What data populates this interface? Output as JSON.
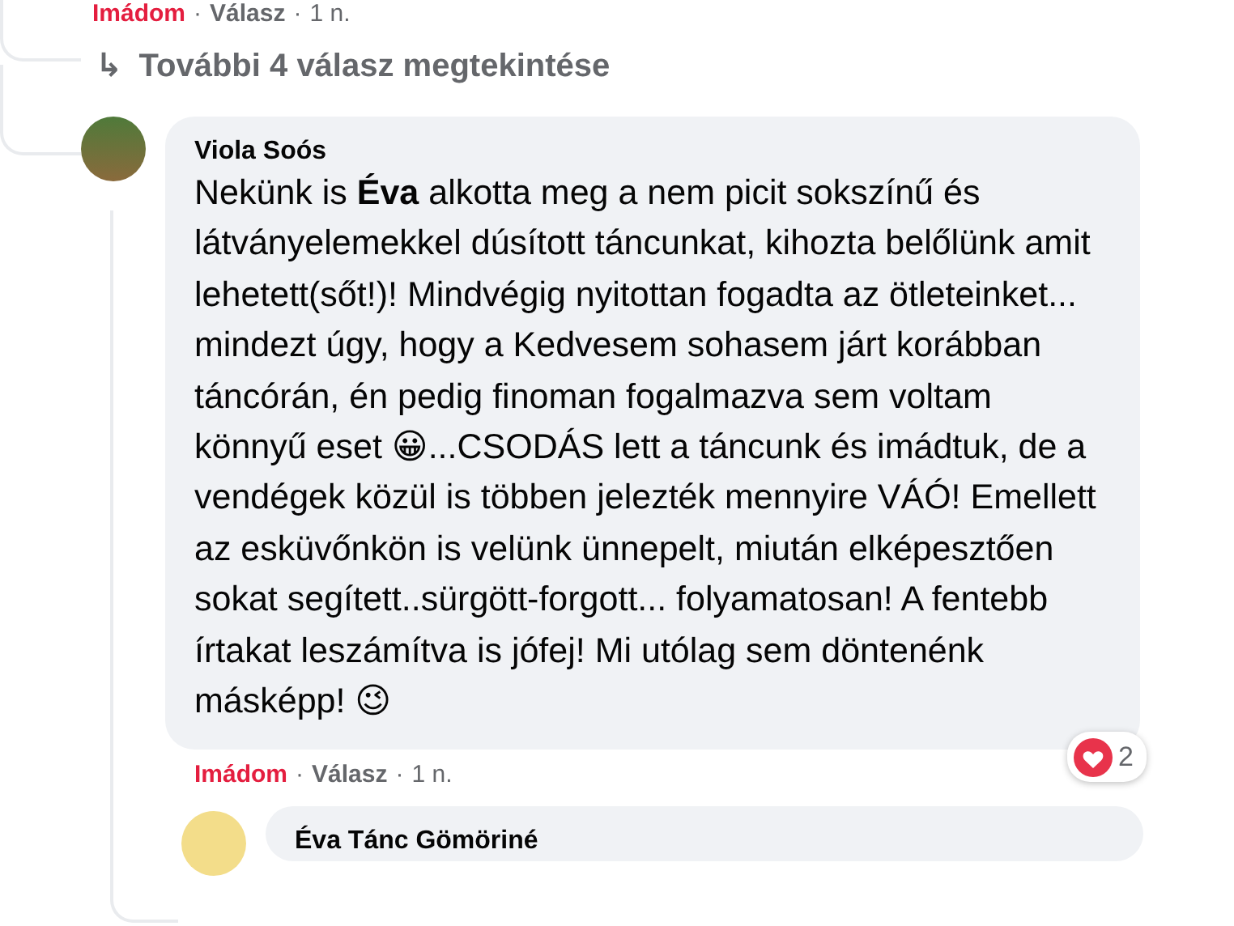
{
  "previous_comment_actions": {
    "reaction": "Imádom",
    "reacted": true,
    "separator": "·",
    "reply": "Válasz",
    "time": "1 n."
  },
  "more_replies": {
    "arrow": "↳",
    "label": "További 4 válasz megtekintése"
  },
  "comments": [
    {
      "author": "Viola Soós",
      "text": "Nekünk is **Éva** alkotta meg a nem picit sokszínű és látványelemekkel dúsított táncunkat, kihozta belőlünk amit lehetett(sőt!)! Mindvégig nyitottan fogadta az ötleteinket... mindezt úgy, hogy a Kedvesem sohasem járt korábban táncórán, én pedig finoman fogalmazva sem voltam könnyű eset 😀...CSODÁS lett a táncunk és imádtuk, de a vendégek közül is többen jelezték mennyire VÁÓ! Emellett az esküvőnkön is velünk ünnepelt, miután elképesztően sokat segített..sürgött-forgott... folyamatosan! A fentebb írtakat leszámítva is jófej! Mi utólag sem döntenénk másképp! 😉",
      "reaction_count": "2",
      "actions": {
        "reaction": "Imádom",
        "reacted": true,
        "separator": "·",
        "reply": "Válasz",
        "time": "1 n."
      }
    },
    {
      "author": "Éva Tánc Gömöriné"
    }
  ]
}
